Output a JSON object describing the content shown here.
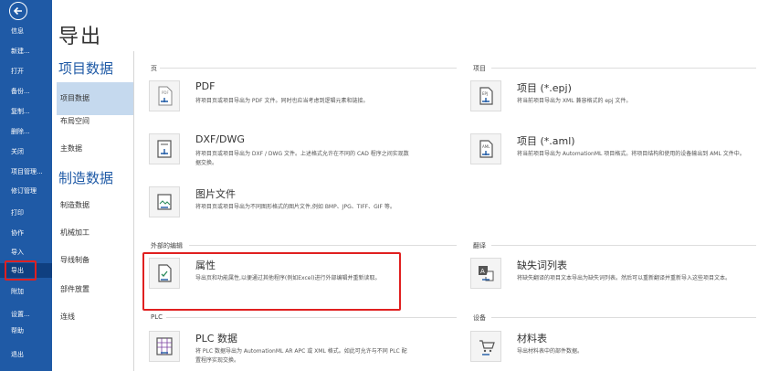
{
  "sidebar": {
    "items": [
      {
        "label": "信息"
      },
      {
        "label": "新建..."
      },
      {
        "label": "打开"
      },
      {
        "label": "备份..."
      },
      {
        "label": "复制..."
      },
      {
        "label": "删除..."
      },
      {
        "label": "关闭"
      },
      {
        "label": "项目管理..."
      },
      {
        "label": "修订管理"
      },
      {
        "label": "打印"
      },
      {
        "label": "协作"
      },
      {
        "label": "导入"
      },
      {
        "label": "导出"
      },
      {
        "label": "附加"
      },
      {
        "label": "设置..."
      },
      {
        "label": "帮助"
      },
      {
        "label": "退出"
      }
    ],
    "active": "导出"
  },
  "page_title": "导出",
  "categories": {
    "project_header": "项目数据",
    "project_items": [
      "项目数据",
      "布局空间",
      "主数据"
    ],
    "manufacturing_header": "制造数据",
    "manufacturing_items": [
      "制造数据",
      "机械加工",
      "导线制备",
      "部件放置",
      "连线"
    ]
  },
  "sections": {
    "page": "页",
    "project": "项目",
    "external_edit": "外部的编辑",
    "translation": "翻译",
    "plc": "PLC",
    "device": "设备"
  },
  "entries": {
    "pdf": {
      "title": "PDF",
      "desc": "将项目页或项目导出为 PDF 文件。同时也应当考虑到逻辑元素和链接。"
    },
    "dxf": {
      "title": "DXF/DWG",
      "desc": "将项目页或项目导出为 DXF / DWG 文件。上述格式允许在不同的 CAD 程序之间实现数据交换。"
    },
    "image": {
      "title": "图片文件",
      "desc": "将项目页或项目导出为不同图形格式的图片文件,例如 BMP、JPG、TIFF、GIF 等。"
    },
    "attributes": {
      "title": "属性",
      "desc": "导出页和功能属性,以便通过其他程序(例如Excel)进行外部编辑并重新读取。"
    },
    "plc_data": {
      "title": "PLC 数据",
      "desc": "将 PLC 数据导出为 AutomationML AR APC 或 XML 格式。如此可允许与不同 PLC 配置程序实现交换。"
    },
    "epj": {
      "title": "项目 (*.epj)",
      "desc": "将当前项目导出为 XML 兼容格式的 epj 文件。"
    },
    "aml": {
      "title": "项目 (*.aml)",
      "desc": "将当前项目导出为 AutomationML 项目格式。将项目结构和使用的设备输出到 AML 文件中。"
    },
    "missing_words": {
      "title": "缺失词列表",
      "desc": "将缺失翻译的项目文本导出为缺失词列表。然后可以重新翻译并重新导入这些项目文本。"
    },
    "bom": {
      "title": "材料表",
      "desc": "导出材料表中的部件数据。"
    }
  },
  "colors": {
    "sidebar": "#1f5aa6",
    "accent": "#1f5aa6",
    "highlight": "#c5d9ee",
    "annotation": "#e02020"
  }
}
